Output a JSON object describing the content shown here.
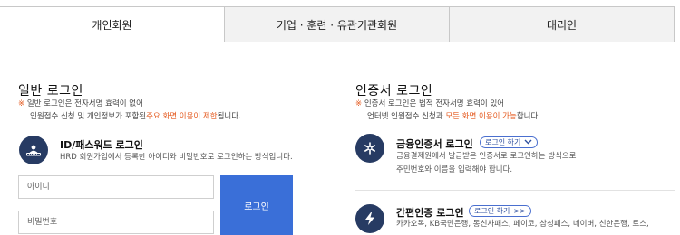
{
  "tabs": [
    {
      "label": "개인회원",
      "active": true
    },
    {
      "label": "기업 · 훈련 · 유관기관회원",
      "active": false
    },
    {
      "label": "대리인",
      "active": false
    }
  ],
  "general_login": {
    "title": "일반 로그인",
    "note_mark": "※",
    "note_line1": " 일반 로그인은 전자서명 효력이 없어",
    "note_line2_pre": "인원접수 신청 및 개인정보가 포함된",
    "note_line2_hl": "주요 화면 이용이 제한",
    "note_line2_post": "됩니다.",
    "id_login": {
      "icon": "id-card-icon",
      "title": "ID/패스워드 로그인",
      "desc": "HRD 회원가입에서 등록한 아이디와 비밀번호로 로그인하는 방식입니다."
    },
    "id_placeholder": "아이디",
    "password_placeholder": "비밀번호",
    "login_button": "로그인"
  },
  "cert_login": {
    "title": "인증서 로그인",
    "note_mark": "※",
    "note_line1": " 인증서 로그인은 법적 전자서명 효력이 있어",
    "note_line2_pre": "언터넷 인원접수 신청과 ",
    "note_line2_hl": "모든 화면 이용이 가능",
    "note_line2_post": "합니다.",
    "financial": {
      "icon": "asterisk-icon",
      "title": "금융인증서 로그인",
      "pill": "로그인 하기",
      "pill_icon": "chevron-down-icon",
      "desc1": "금융결제원에서 발급받은 인증서로 로그인하는 방식으로",
      "desc2": "주민번호와 이름을 입력해야 합니다."
    },
    "simple": {
      "icon": "lightning-icon",
      "title": "간편인증 로그인",
      "pill": "로그인 하기",
      "pill_icon": "double-chevron-right-icon",
      "desc": "카카오톡, KB국민은행, 통신사패스, 페이코, 삼성패스, 네이버, 신한은행, 토스,"
    }
  },
  "colors": {
    "accent_blue": "#3a6fd8",
    "icon_navy": "#273b63",
    "highlight_orange": "#e55a1f"
  }
}
